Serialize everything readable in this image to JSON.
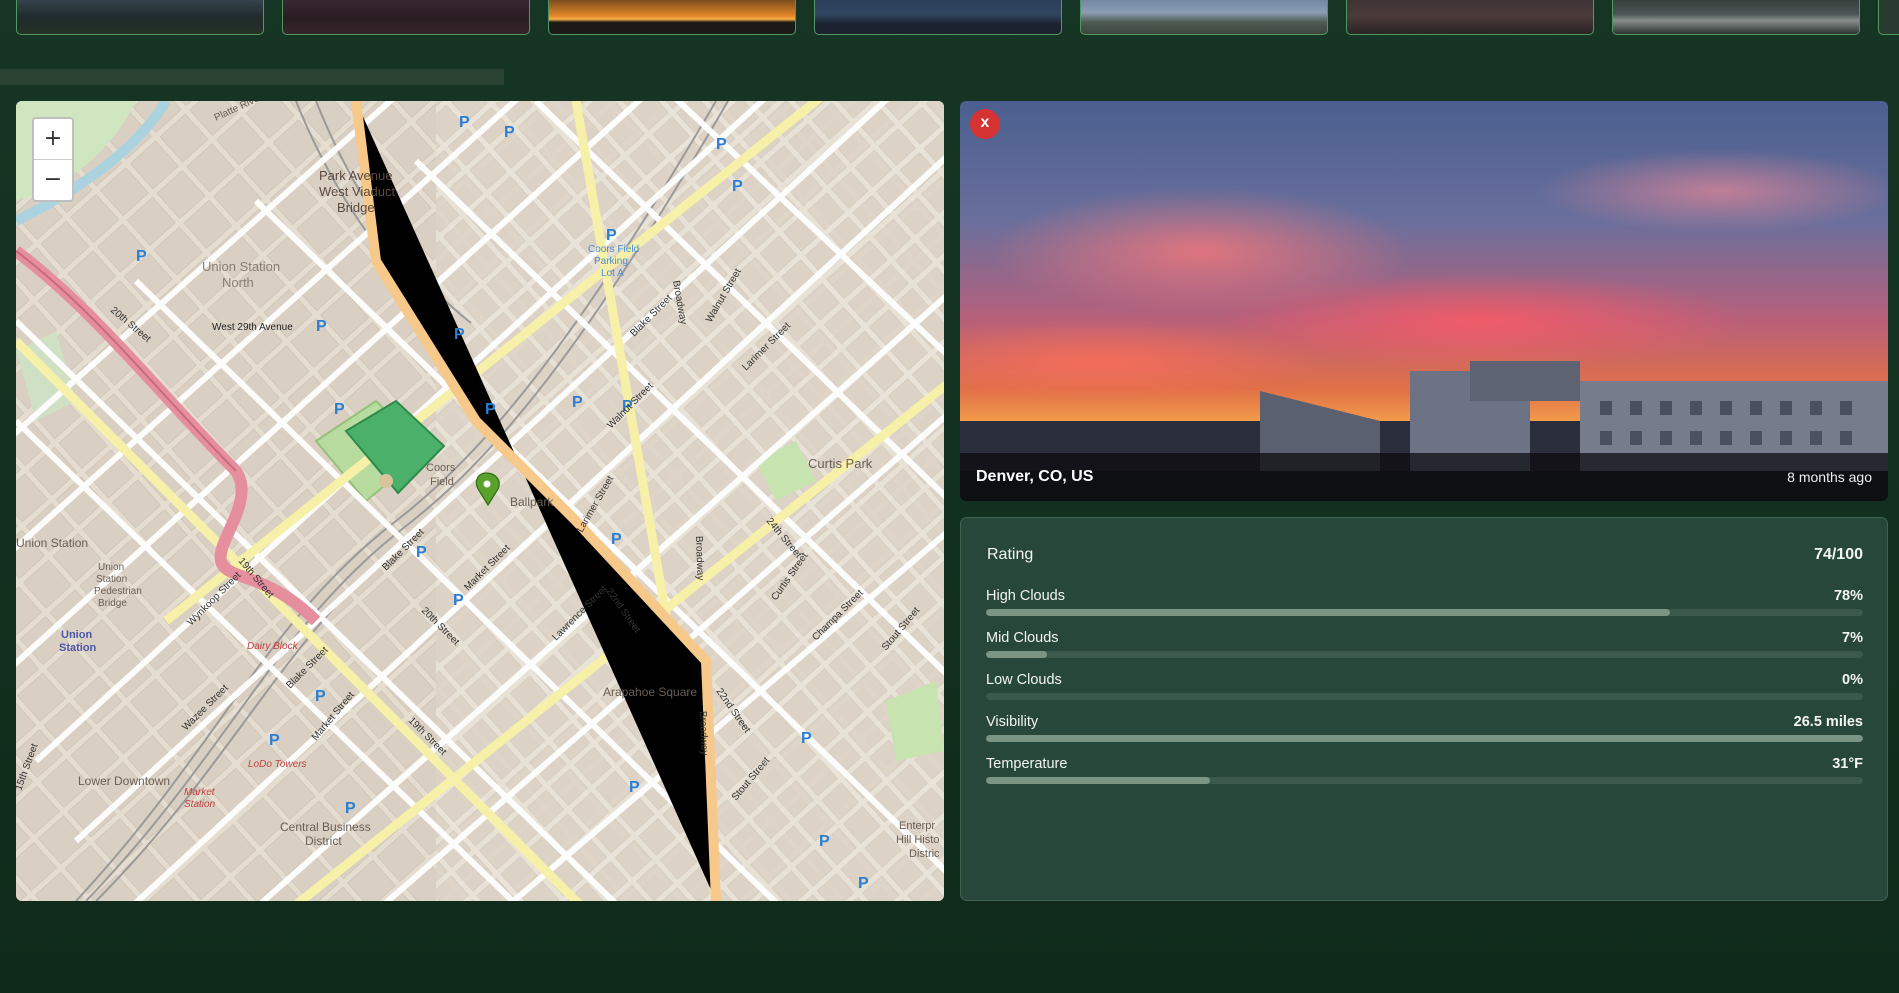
{
  "thumbnails": [
    {
      "name": "thumb-1"
    },
    {
      "name": "thumb-2"
    },
    {
      "name": "thumb-3"
    },
    {
      "name": "thumb-4"
    },
    {
      "name": "thumb-5"
    },
    {
      "name": "thumb-6"
    },
    {
      "name": "thumb-7"
    },
    {
      "name": "thumb-8"
    }
  ],
  "map": {
    "zoom_in_label": "+",
    "zoom_out_label": "−",
    "labels": {
      "park_avenue": "Park Avenue",
      "west_viaduct": "West Viaduct",
      "bridge": "Bridge",
      "union_station_north": "Union Station",
      "north": "North",
      "coors_lot": "Coors Field",
      "parking": "Parking",
      "lot_a": "Lot A",
      "west_29th": "West 29th Avenue",
      "coors_field": "Coors",
      "field": "Field",
      "ballpark": "Ballpark",
      "curtis_park": "Curtis Park",
      "union_station": "Union Station",
      "union_station_bridge_1": "Union",
      "union_station_bridge_2": "Station",
      "union_station_bridge_3": "Pedestrian",
      "union_station_bridge_4": "Bridge",
      "union_station_stop_1": "Union",
      "union_station_stop_2": "Station",
      "dairy_block": "Dairy Block",
      "lodo_towers": "LoDo Towers",
      "lower_downtown": "Lower Downtown",
      "market_station_1": "Market",
      "market_station_2": "Station",
      "cbd_1": "Central Business",
      "cbd_2": "District",
      "arapahoe_square": "Arapahoe Square",
      "enterprise_1": "Enterpr",
      "enterprise_2": "Hill Histo",
      "enterprise_3": "Distric",
      "broadway": "Broadway",
      "blake_street": "Blake Street",
      "walnut_street": "Walnut Street",
      "larimer_street": "Larimer Street",
      "lawrence_street": "Lawrence Street",
      "champa_street": "Champa Street",
      "stout_street": "Stout Street",
      "curtis_street": "Curtis Street",
      "market_street": "Market Street",
      "wazee_street": "Wazee Street",
      "wynkoop_street": "Wynkoop Street",
      "street_20th": "20th Street",
      "street_19th": "19th Street",
      "street_22nd": "22nd Street",
      "street_24th": "24th Street",
      "street_15th": "15th Street",
      "platte_river": "Platte River Trail"
    },
    "accent_colors": {
      "marker": "#5aa02c",
      "street_major": "#f6d4a0",
      "street_minor": "#ffffff",
      "highway": "#e58f9e",
      "park": "#c8e4b0",
      "water": "#aad3df"
    }
  },
  "photo": {
    "close_label": "x",
    "location": "Denver, CO, US",
    "time_ago": "8 months ago"
  },
  "stats": {
    "rating_label": "Rating",
    "rating_value": "74/100",
    "items": [
      {
        "label": "High Clouds",
        "value": "78%",
        "fraction": 0.78
      },
      {
        "label": "Mid Clouds",
        "value": "7%",
        "fraction": 0.07
      },
      {
        "label": "Low Clouds",
        "value": "0%",
        "fraction": 0.0
      },
      {
        "label": "Visibility",
        "value": "26.5 miles",
        "fraction": 1.0
      },
      {
        "label": "Temperature",
        "value": "31°F",
        "fraction": 0.255
      }
    ]
  }
}
